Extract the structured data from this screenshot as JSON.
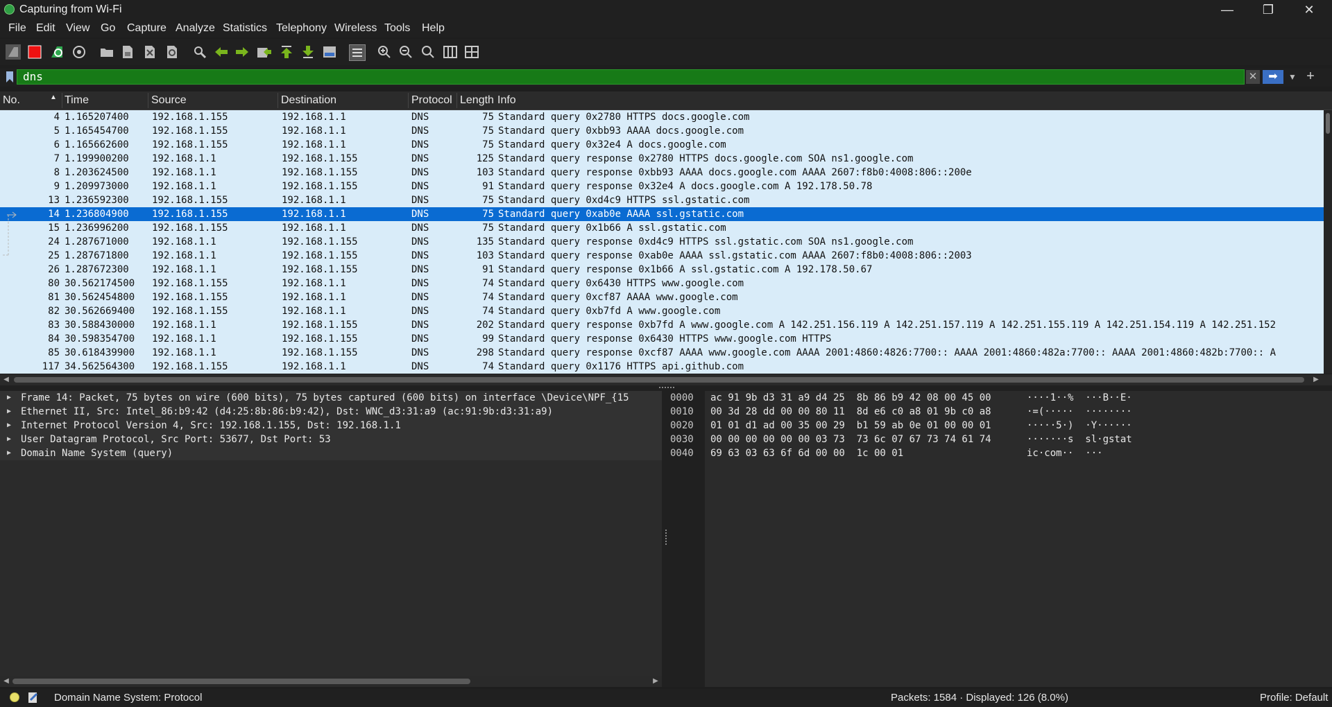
{
  "window": {
    "title": "Capturing from Wi-Fi",
    "minimize": "—",
    "restore": "❐",
    "close": "✕"
  },
  "menu": [
    "File",
    "Edit",
    "View",
    "Go",
    "Capture",
    "Analyze",
    "Statistics",
    "Telephony",
    "Wireless",
    "Tools",
    "Help"
  ],
  "toolbar": {
    "icons": [
      "start-capture-icon",
      "stop-capture-icon",
      "restart-capture-icon",
      "capture-options-icon",
      "open-file-icon",
      "save-file-icon",
      "close-file-icon",
      "reload-file-icon",
      "find-packet-icon",
      "go-back-icon",
      "go-forward-icon",
      "go-to-packet-icon",
      "first-packet-icon",
      "last-packet-icon",
      "auto-scroll-icon",
      "colorize-icon",
      "zoom-in-icon",
      "zoom-out-icon",
      "normal-size-icon",
      "resize-columns-icon",
      "layout-icon"
    ]
  },
  "filter": {
    "value": "dns",
    "apply_icon": "arrow-right-icon",
    "add_icon": "plus-icon"
  },
  "packet_list": {
    "columns": [
      "No.",
      "Time",
      "Source",
      "Destination",
      "Protocol",
      "Length",
      "Info"
    ],
    "selected_index": 7,
    "rows": [
      {
        "no": "4",
        "time": "1.165207400",
        "src": "192.168.1.155",
        "dst": "192.168.1.1",
        "proto": "DNS",
        "len": "75",
        "info": "Standard query 0x2780 HTTPS docs.google.com"
      },
      {
        "no": "5",
        "time": "1.165454700",
        "src": "192.168.1.155",
        "dst": "192.168.1.1",
        "proto": "DNS",
        "len": "75",
        "info": "Standard query 0xbb93 AAAA docs.google.com"
      },
      {
        "no": "6",
        "time": "1.165662600",
        "src": "192.168.1.155",
        "dst": "192.168.1.1",
        "proto": "DNS",
        "len": "75",
        "info": "Standard query 0x32e4 A docs.google.com"
      },
      {
        "no": "7",
        "time": "1.199900200",
        "src": "192.168.1.1",
        "dst": "192.168.1.155",
        "proto": "DNS",
        "len": "125",
        "info": "Standard query response 0x2780 HTTPS docs.google.com SOA ns1.google.com"
      },
      {
        "no": "8",
        "time": "1.203624500",
        "src": "192.168.1.1",
        "dst": "192.168.1.155",
        "proto": "DNS",
        "len": "103",
        "info": "Standard query response 0xbb93 AAAA docs.google.com AAAA 2607:f8b0:4008:806::200e"
      },
      {
        "no": "9",
        "time": "1.209973000",
        "src": "192.168.1.1",
        "dst": "192.168.1.155",
        "proto": "DNS",
        "len": "91",
        "info": "Standard query response 0x32e4 A docs.google.com A 192.178.50.78"
      },
      {
        "no": "13",
        "time": "1.236592300",
        "src": "192.168.1.155",
        "dst": "192.168.1.1",
        "proto": "DNS",
        "len": "75",
        "info": "Standard query 0xd4c9 HTTPS ssl.gstatic.com"
      },
      {
        "no": "14",
        "time": "1.236804900",
        "src": "192.168.1.155",
        "dst": "192.168.1.1",
        "proto": "DNS",
        "len": "75",
        "info": "Standard query 0xab0e AAAA ssl.gstatic.com"
      },
      {
        "no": "15",
        "time": "1.236996200",
        "src": "192.168.1.155",
        "dst": "192.168.1.1",
        "proto": "DNS",
        "len": "75",
        "info": "Standard query 0x1b66 A ssl.gstatic.com"
      },
      {
        "no": "24",
        "time": "1.287671000",
        "src": "192.168.1.1",
        "dst": "192.168.1.155",
        "proto": "DNS",
        "len": "135",
        "info": "Standard query response 0xd4c9 HTTPS ssl.gstatic.com SOA ns1.google.com"
      },
      {
        "no": "25",
        "time": "1.287671800",
        "src": "192.168.1.1",
        "dst": "192.168.1.155",
        "proto": "DNS",
        "len": "103",
        "info": "Standard query response 0xab0e AAAA ssl.gstatic.com AAAA 2607:f8b0:4008:806::2003"
      },
      {
        "no": "26",
        "time": "1.287672300",
        "src": "192.168.1.1",
        "dst": "192.168.1.155",
        "proto": "DNS",
        "len": "91",
        "info": "Standard query response 0x1b66 A ssl.gstatic.com A 192.178.50.67"
      },
      {
        "no": "80",
        "time": "30.562174500",
        "src": "192.168.1.155",
        "dst": "192.168.1.1",
        "proto": "DNS",
        "len": "74",
        "info": "Standard query 0x6430 HTTPS www.google.com"
      },
      {
        "no": "81",
        "time": "30.562454800",
        "src": "192.168.1.155",
        "dst": "192.168.1.1",
        "proto": "DNS",
        "len": "74",
        "info": "Standard query 0xcf87 AAAA www.google.com"
      },
      {
        "no": "82",
        "time": "30.562669400",
        "src": "192.168.1.155",
        "dst": "192.168.1.1",
        "proto": "DNS",
        "len": "74",
        "info": "Standard query 0xb7fd A www.google.com"
      },
      {
        "no": "83",
        "time": "30.588430000",
        "src": "192.168.1.1",
        "dst": "192.168.1.155",
        "proto": "DNS",
        "len": "202",
        "info": "Standard query response 0xb7fd A www.google.com A 142.251.156.119 A 142.251.157.119 A 142.251.155.119 A 142.251.154.119 A 142.251.152"
      },
      {
        "no": "84",
        "time": "30.598354700",
        "src": "192.168.1.1",
        "dst": "192.168.1.155",
        "proto": "DNS",
        "len": "99",
        "info": "Standard query response 0x6430 HTTPS www.google.com HTTPS"
      },
      {
        "no": "85",
        "time": "30.618439900",
        "src": "192.168.1.1",
        "dst": "192.168.1.155",
        "proto": "DNS",
        "len": "298",
        "info": "Standard query response 0xcf87 AAAA www.google.com AAAA 2001:4860:4826:7700:: AAAA 2001:4860:482a:7700:: AAAA 2001:4860:482b:7700:: A"
      },
      {
        "no": "117",
        "time": "34.562564300",
        "src": "192.168.1.155",
        "dst": "192.168.1.1",
        "proto": "DNS",
        "len": "74",
        "info": "Standard query 0x1176 HTTPS api.github.com"
      }
    ]
  },
  "details": [
    "Frame 14: Packet, 75 bytes on wire (600 bits), 75 bytes captured (600 bits) on interface \\Device\\NPF_{15",
    "Ethernet II, Src: Intel_86:b9:42 (d4:25:8b:86:b9:42), Dst: WNC_d3:31:a9 (ac:91:9b:d3:31:a9)",
    "Internet Protocol Version 4, Src: 192.168.1.155, Dst: 192.168.1.1",
    "User Datagram Protocol, Src Port: 53677, Dst Port: 53",
    "Domain Name System (query)"
  ],
  "bytes": [
    {
      "offset": "0000",
      "hex": "ac 91 9b d3 31 a9 d4 25  8b 86 b9 42 08 00 45 00",
      "ascii": "····1··%  ···B··E·"
    },
    {
      "offset": "0010",
      "hex": "00 3d 28 dd 00 00 80 11  8d e6 c0 a8 01 9b c0 a8",
      "ascii": "·=(·····  ········"
    },
    {
      "offset": "0020",
      "hex": "01 01 d1 ad 00 35 00 29  b1 59 ab 0e 01 00 00 01",
      "ascii": "·····5·)  ·Y······"
    },
    {
      "offset": "0030",
      "hex": "00 00 00 00 00 00 03 73  73 6c 07 67 73 74 61 74",
      "ascii": "·······s  sl·gstat"
    },
    {
      "offset": "0040",
      "hex": "69 63 03 63 6f 6d 00 00  1c 00 01",
      "ascii": "ic·com··  ···"
    }
  ],
  "status": {
    "field": "Domain Name System: Protocol",
    "packets": "Packets: 1584 · Displayed: 126 (8.0%)",
    "profile": "Profile: Default"
  }
}
